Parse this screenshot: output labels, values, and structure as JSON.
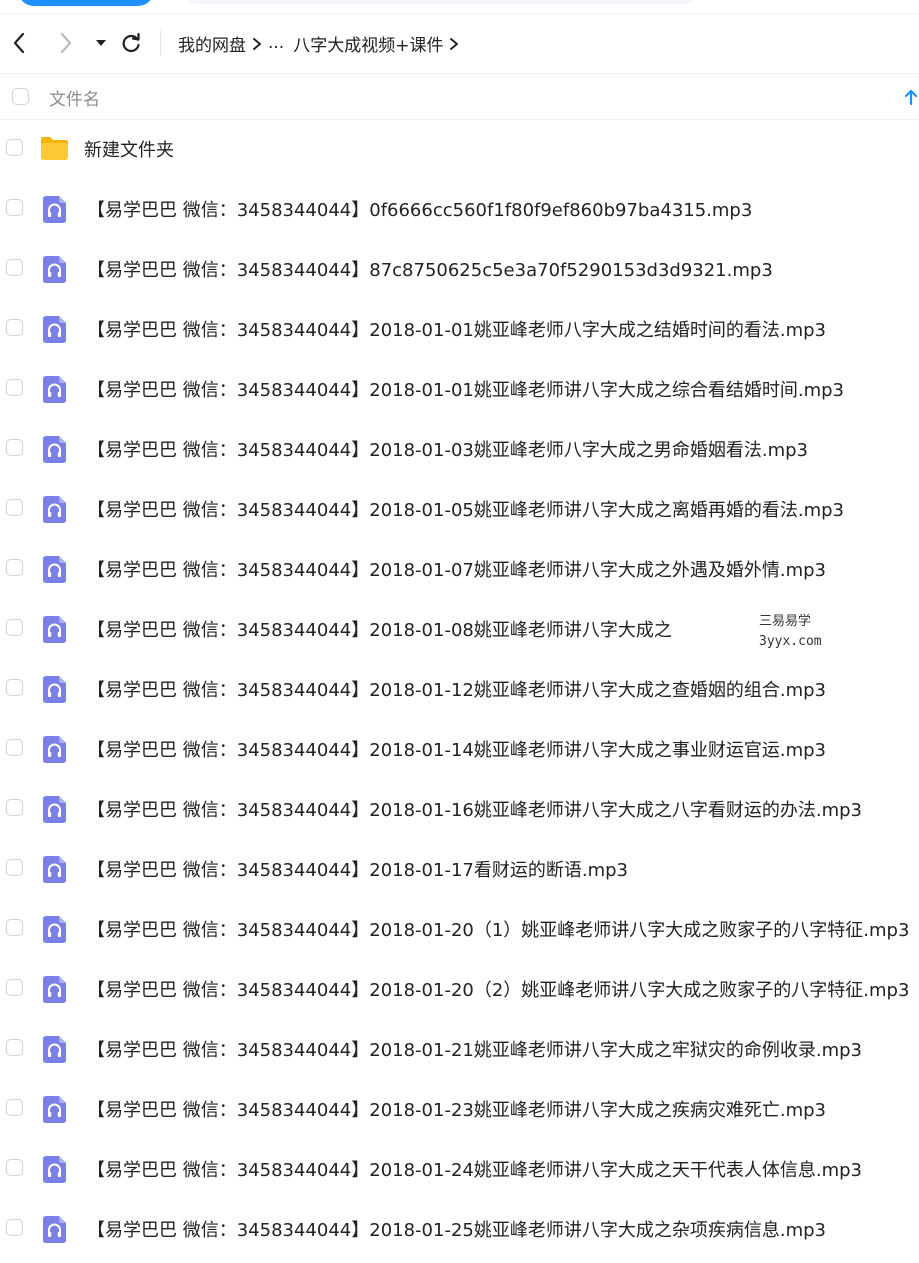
{
  "nav": {
    "breadcrumbs": [
      "我的网盘",
      "...",
      "八字大成视频+课件"
    ]
  },
  "header": {
    "column_label": "文件名"
  },
  "watermark": {
    "line1": "三易易学",
    "line2": "3yyx.com"
  },
  "files": [
    {
      "type": "folder",
      "name": "新建文件夹"
    },
    {
      "type": "audio",
      "name": "【易学巴巴 微信：3458344044】0f6666cc560f1f80f9ef860b97ba4315.mp3"
    },
    {
      "type": "audio",
      "name": "【易学巴巴 微信：3458344044】87c8750625c5e3a70f5290153d3d9321.mp3"
    },
    {
      "type": "audio",
      "name": "【易学巴巴 微信：3458344044】2018-01-01姚亚峰老师八字大成之结婚时间的看法.mp3"
    },
    {
      "type": "audio",
      "name": "【易学巴巴 微信：3458344044】2018-01-01姚亚峰老师讲八字大成之综合看结婚时间.mp3"
    },
    {
      "type": "audio",
      "name": "【易学巴巴 微信：3458344044】2018-01-03姚亚峰老师八字大成之男命婚姻看法.mp3"
    },
    {
      "type": "audio",
      "name": "【易学巴巴 微信：3458344044】2018-01-05姚亚峰老师讲八字大成之离婚再婚的看法.mp3"
    },
    {
      "type": "audio",
      "name": "【易学巴巴 微信：3458344044】2018-01-07姚亚峰老师讲八字大成之外遇及婚外情.mp3"
    },
    {
      "type": "audio",
      "name": "【易学巴巴 微信：3458344044】2018-01-08姚亚峰老师讲八字大成之"
    },
    {
      "type": "audio",
      "name": "【易学巴巴 微信：3458344044】2018-01-12姚亚峰老师讲八字大成之查婚姻的组合.mp3"
    },
    {
      "type": "audio",
      "name": "【易学巴巴 微信：3458344044】2018-01-14姚亚峰老师讲八字大成之事业财运官运.mp3"
    },
    {
      "type": "audio",
      "name": "【易学巴巴 微信：3458344044】2018-01-16姚亚峰老师讲八字大成之八字看财运的办法.mp3"
    },
    {
      "type": "audio",
      "name": "【易学巴巴 微信：3458344044】2018-01-17看财运的断语.mp3"
    },
    {
      "type": "audio",
      "name": "【易学巴巴 微信：3458344044】2018-01-20（1）姚亚峰老师讲八字大成之败家子的八字特征.mp3"
    },
    {
      "type": "audio",
      "name": "【易学巴巴 微信：3458344044】2018-01-20（2）姚亚峰老师讲八字大成之败家子的八字特征.mp3"
    },
    {
      "type": "audio",
      "name": "【易学巴巴 微信：3458344044】2018-01-21姚亚峰老师讲八字大成之牢狱灾的命例收录.mp3"
    },
    {
      "type": "audio",
      "name": "【易学巴巴 微信：3458344044】2018-01-23姚亚峰老师讲八字大成之疾病灾难死亡.mp3"
    },
    {
      "type": "audio",
      "name": "【易学巴巴 微信：3458344044】2018-01-24姚亚峰老师讲八字大成之天干代表人体信息.mp3"
    },
    {
      "type": "audio",
      "name": "【易学巴巴 微信：3458344044】2018-01-25姚亚峰老师讲八字大成之杂项疾病信息.mp3"
    }
  ],
  "colors": {
    "accent": "#1e90ff",
    "audio_icon": "#7b80e8",
    "folder": "#ffc933"
  }
}
